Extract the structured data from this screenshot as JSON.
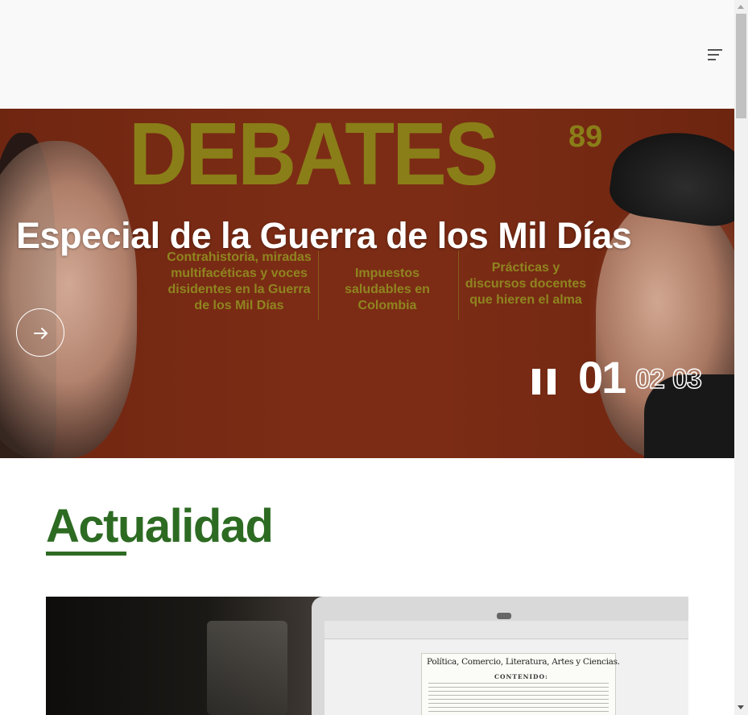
{
  "header": {
    "menu_icon": "hamburger-menu-icon"
  },
  "hero": {
    "cover_brand": "DEBATES",
    "cover_number": "89",
    "title": "Especial de la Guerra de los Mil Días",
    "topics": [
      {
        "label": "Contrahistoria, miradas multifacéticas y voces disidentes en la Guerra de los Mil Días"
      },
      {
        "label": "Impuestos saludables en Colombia"
      },
      {
        "label": "Prácticas y discursos docentes que hieren el alma"
      }
    ],
    "next_icon": "arrow-right-icon",
    "pause_icon": "pause-icon",
    "slides": {
      "current": "01",
      "others": [
        "02",
        "03"
      ]
    },
    "colors": {
      "background": "#7a2a14",
      "cover_text": "#8a7e18"
    }
  },
  "section": {
    "title": "Actualidad",
    "accent_color": "#2d6b23"
  },
  "article": {
    "doc_heading": "Política, Comercio, Literatura, Artes y Ciencias.",
    "doc_subheading": "CONTENIDO:"
  }
}
